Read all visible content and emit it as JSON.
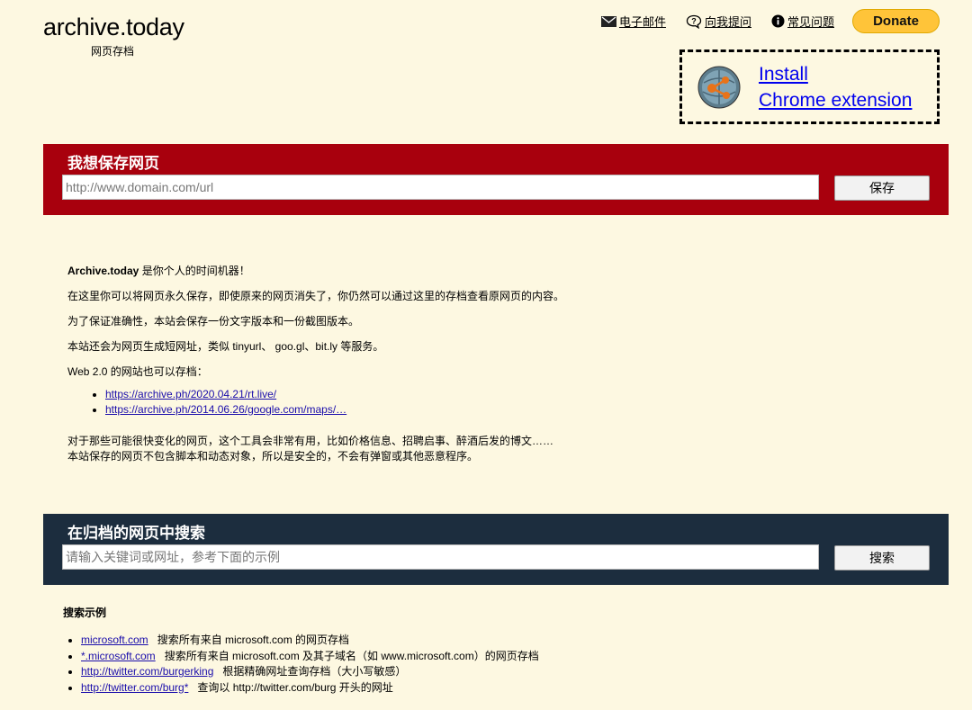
{
  "header": {
    "title": "archive.today",
    "subtitle": "网页存档"
  },
  "nav": {
    "email": "电子邮件",
    "ask": "向我提问",
    "faq": "常见问题",
    "donate": "Donate"
  },
  "extension": {
    "line1": "Install",
    "line2": "Chrome extension"
  },
  "save": {
    "title": "我想保存网页",
    "placeholder": "http://www.domain.com/url",
    "button": "保存"
  },
  "about": {
    "line1_bold": "Archive.today",
    "line1_rest": " 是你个人的时间机器！",
    "line2": "在这里你可以将网页永久保存，即使原来的网页消失了，你仍然可以通过这里的存档查看原网页的内容。",
    "line3": "为了保证准确性，本站会保存一份文字版本和一份截图版本。",
    "line4": "本站还会为网页生成短网址，类似 tinyurl、 goo.gl、bit.ly 等服务。",
    "line5": "Web 2.0 的网站也可以存档：",
    "links": [
      "https://archive.ph/2020.04.21/rt.live/",
      "https://archive.ph/2014.06.26/google.com/maps/…"
    ],
    "line6": "对于那些可能很快变化的网页，这个工具会非常有用，比如价格信息、招聘启事、醉酒后发的博文……",
    "line7": "本站保存的网页不包含脚本和动态对象，所以是安全的，不会有弹窗或其他恶意程序。"
  },
  "search": {
    "title": "在归档的网页中搜索",
    "placeholder": "请输入关键词或网址，参考下面的示例",
    "button": "搜索"
  },
  "examples": {
    "title": "搜索示例",
    "items": [
      {
        "link": "microsoft.com",
        "desc": "搜索所有来自 microsoft.com 的网页存档"
      },
      {
        "link": "*.microsoft.com",
        "desc": "搜索所有来自 microsoft.com 及其子域名（如 www.microsoft.com）的网页存档"
      },
      {
        "link": "http://twitter.com/burgerking",
        "desc": "根据精确网址查询存档（大小写敏感）"
      },
      {
        "link": "http://twitter.com/burg*",
        "desc": "查询以 http://twitter.com/burg 开头的网址"
      }
    ]
  },
  "colors": {
    "background": "#fdf8e1",
    "save_panel": "#a8000d",
    "search_panel": "#1c2d3e",
    "donate": "#ffc439"
  }
}
